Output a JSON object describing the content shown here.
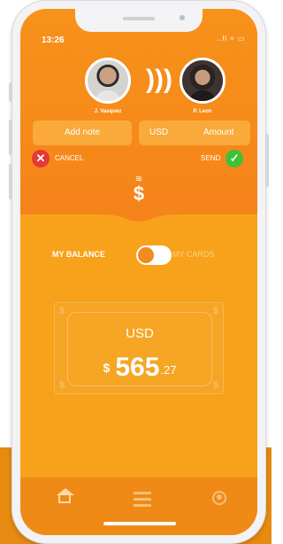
{
  "status": {
    "time": "13:26",
    "icons": "..ll ≈ ▭"
  },
  "sender": {
    "name": "J. Vasquez"
  },
  "receiver": {
    "name": "P. Leon"
  },
  "note_field": {
    "placeholder": "Add note"
  },
  "amount_field": {
    "currency": "USD",
    "placeholder": "Amount"
  },
  "actions": {
    "cancel_label": "CANCEL",
    "send_label": "SEND"
  },
  "toggle": {
    "left_label": "MY BALANCE",
    "right_label": "MY CARDS",
    "selected": "MY BALANCE"
  },
  "balance": {
    "currency": "USD",
    "symbol": "$",
    "integer": "565",
    "decimal": ".27"
  },
  "colors": {
    "primary": "#f7921a",
    "accent": "#f7a21a",
    "cancel": "#e53935",
    "send": "#3fc136"
  },
  "tabs": [
    {
      "icon": "home-icon"
    },
    {
      "icon": "list-icon"
    },
    {
      "icon": "profile-icon"
    }
  ]
}
